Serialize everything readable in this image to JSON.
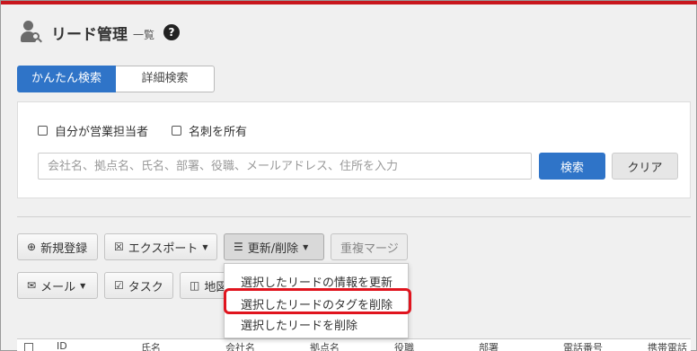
{
  "header": {
    "title": "リード管理",
    "subtitle": "一覧",
    "help": "?"
  },
  "tabs": [
    {
      "label": "かんたん検索",
      "active": true
    },
    {
      "label": "詳細検索",
      "active": false
    }
  ],
  "search": {
    "checkbox_owner": "自分が営業担当者",
    "checkbox_card": "名刺を所有",
    "placeholder": "会社名、拠点名、氏名、部署、役職、メールアドレス、住所を入力",
    "search_label": "検索",
    "clear_label": "クリア"
  },
  "toolbar": {
    "new_label": "新規登録",
    "export_label": "エクスポート",
    "update_label": "更新/削除",
    "merge_label": "重複マージ",
    "mail_label": "メール",
    "task_label": "タスク",
    "map_label": "地図"
  },
  "dropdown": {
    "items": [
      "選択したリードの情報を更新",
      "選択したリードのタグを削除",
      "選択したリードを削除"
    ],
    "highlighted_index": 1
  },
  "table": {
    "columns": [
      "ID",
      "氏名",
      "会社名",
      "拠点名",
      "役職",
      "部署",
      "電話番号",
      "携帯電話"
    ]
  },
  "colors": {
    "accent": "#2f74c8",
    "top_bar": "#c8161d",
    "highlight": "#e0141e"
  }
}
